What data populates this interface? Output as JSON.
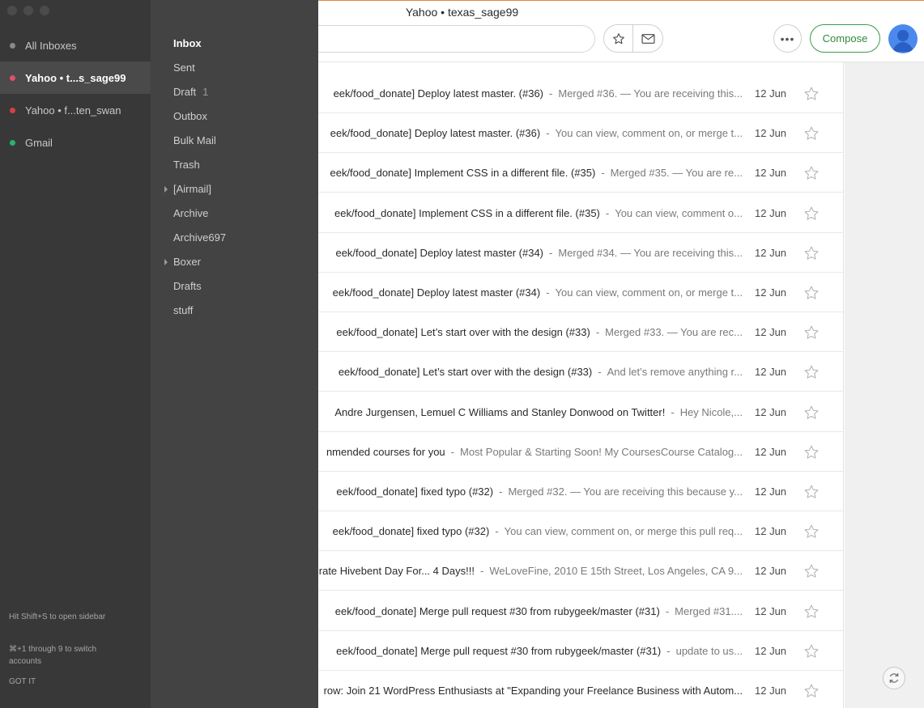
{
  "window": {
    "title": "Yahoo • texas_sage99"
  },
  "toolbar": {
    "compose_label": "Compose"
  },
  "accounts": [
    {
      "label": "All Inboxes",
      "dot_color": "#8a8a8a",
      "active": false
    },
    {
      "label": "Yahoo • t...s_sage99",
      "dot_color": "#e0506a",
      "active": true
    },
    {
      "label": "Yahoo • f...ten_swan",
      "dot_color": "#d64040",
      "active": false
    },
    {
      "label": "Gmail",
      "dot_color": "#2bb36a",
      "active": false
    }
  ],
  "sidebar_hints": {
    "open_sidebar": "Hit Shift+S to open sidebar",
    "switch_accounts": "⌘+1 through 9 to switch accounts",
    "got_it": "GOT IT"
  },
  "folders": [
    {
      "label": "Inbox",
      "count": "",
      "active": true,
      "expandable": false
    },
    {
      "label": "Sent",
      "count": "",
      "active": false,
      "expandable": false
    },
    {
      "label": "Draft",
      "count": "1",
      "active": false,
      "expandable": false
    },
    {
      "label": "Outbox",
      "count": "",
      "active": false,
      "expandable": false
    },
    {
      "label": "Bulk Mail",
      "count": "",
      "active": false,
      "expandable": false
    },
    {
      "label": "Trash",
      "count": "",
      "active": false,
      "expandable": false
    },
    {
      "label": "[Airmail]",
      "count": "",
      "active": false,
      "expandable": true
    },
    {
      "label": "Archive",
      "count": "",
      "active": false,
      "expandable": false
    },
    {
      "label": "Archive697",
      "count": "",
      "active": false,
      "expandable": false
    },
    {
      "label": "Boxer",
      "count": "",
      "active": false,
      "expandable": true
    },
    {
      "label": "Drafts",
      "count": "",
      "active": false,
      "expandable": false
    },
    {
      "label": "stuff",
      "count": "",
      "active": false,
      "expandable": false
    }
  ],
  "messages": [
    {
      "subject": "eek/food_donate] Deploy latest master. (#36)",
      "snippet": "Merged #36. — You are receiving this...",
      "date": "12 Jun"
    },
    {
      "subject": "eek/food_donate] Deploy latest master. (#36)",
      "snippet": "You can view, comment on, or merge t...",
      "date": "12 Jun"
    },
    {
      "subject": "eek/food_donate] Implement CSS in a different file. (#35)",
      "snippet": "Merged #35. — You are re...",
      "date": "12 Jun"
    },
    {
      "subject": "eek/food_donate] Implement CSS in a different file. (#35)",
      "snippet": "You can view, comment o...",
      "date": "12 Jun"
    },
    {
      "subject": "eek/food_donate] Deploy latest master (#34)",
      "snippet": "Merged #34. — You are receiving this...",
      "date": "12 Jun"
    },
    {
      "subject": "eek/food_donate] Deploy latest master (#34)",
      "snippet": "You can view, comment on, or merge t...",
      "date": "12 Jun"
    },
    {
      "subject": "eek/food_donate] Let’s start over with the design (#33)",
      "snippet": "Merged #33. — You are rec...",
      "date": "12 Jun"
    },
    {
      "subject": "eek/food_donate] Let’s start over with the design (#33)",
      "snippet": "And let’s remove anything r...",
      "date": "12 Jun"
    },
    {
      "subject": "Andre Jurgensen, Lemuel C Williams and Stanley Donwood on Twitter!",
      "snippet": "Hey Nicole,...",
      "date": "12 Jun"
    },
    {
      "subject": "nmended courses for you",
      "snippet": "Most Popular & Starting Soon! My CoursesCourse Catalog...",
      "date": "12 Jun"
    },
    {
      "subject": "eek/food_donate] fixed typo (#32)",
      "snippet": "Merged #32. — You are receiving this because y...",
      "date": "12 Jun"
    },
    {
      "subject": "eek/food_donate] fixed typo (#32)",
      "snippet": "You can view, comment on, or merge this pull req...",
      "date": "12 Jun"
    },
    {
      "subject": "rate Hivebent Day For... 4 Days!!!",
      "snippet": "WeLoveFine, 2010 E 15th Street, Los Angeles, CA 9...",
      "date": "12 Jun"
    },
    {
      "subject": "eek/food_donate] Merge pull request #30 from rubygeek/master (#31)",
      "snippet": "Merged #31....",
      "date": "12 Jun"
    },
    {
      "subject": "eek/food_donate] Merge pull request #30 from rubygeek/master (#31)",
      "snippet": "update to us...",
      "date": "12 Jun"
    },
    {
      "subject": "row: Join 21 WordPress Enthusiasts at \"Expanding your Freelance Business with Autom...",
      "snippet": "",
      "date": "12 Jun"
    }
  ],
  "separator": "-",
  "icons": {
    "favorites": "star-icon",
    "mail": "envelope-icon",
    "more": "ellipsis-icon",
    "avatar": "user-avatar-icon",
    "refresh": "refresh-icon"
  },
  "colors": {
    "accent": "#2f8a3e",
    "avatar": "#4b89ee",
    "sidebar_bg": "#383838",
    "folders_bg": "#434343"
  }
}
